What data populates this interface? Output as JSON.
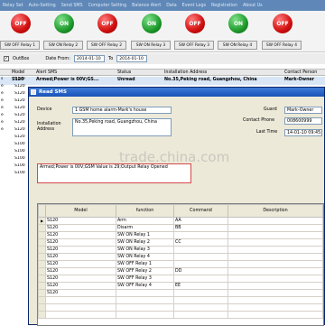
{
  "menu": [
    "Relay Set",
    "Auto-Setting",
    "Send SMS",
    "Computer Setting",
    "Balance Alert",
    "Data",
    "Event Logs",
    "Registration",
    "About Us"
  ],
  "relays": [
    {
      "state": "OFF",
      "color": "red",
      "label": "SW OFF Relay 1"
    },
    {
      "state": "ON",
      "color": "green",
      "label": "SW ON Relay 2"
    },
    {
      "state": "OFF",
      "color": "red",
      "label": "SW OFF Relay 2"
    },
    {
      "state": "ON",
      "color": "green",
      "label": "SW ON Relay 3"
    },
    {
      "state": "OFF",
      "color": "red",
      "label": "SW OFF Relay 3"
    },
    {
      "state": "ON",
      "color": "green",
      "label": "SW ON Relay 4"
    },
    {
      "state": "OFF",
      "color": "red",
      "label": "SW OFF Relay 4"
    }
  ],
  "filter": {
    "outbox": "OutBox",
    "date_from_label": "Date From:",
    "date_from": "2014-01-10",
    "to_label": "To",
    "date_to": "2014-01-10"
  },
  "bg_table": {
    "headers": [
      "Model",
      "Alert SMS",
      "Status",
      "Installation Address",
      "Contact Person"
    ],
    "first_row": {
      "model": "S120",
      "sms": "Armed;Power is 00V;GS...",
      "status": "Unread",
      "address": "No.35,Peking road, Guangzhou, China",
      "contact": "Mark-Owner"
    },
    "left_col": [
      {
        "n": "s",
        "m": "S120"
      },
      {
        "n": "e",
        "m": "S120"
      },
      {
        "n": "e",
        "m": "S120"
      },
      {
        "n": "e",
        "m": "S120"
      },
      {
        "n": "e",
        "m": "S120"
      },
      {
        "n": "e",
        "m": "S120"
      },
      {
        "n": "e",
        "m": "S120"
      },
      {
        "n": "e",
        "m": "S120"
      },
      {
        "n": "",
        "m": "S120"
      },
      {
        "n": "",
        "m": "S100"
      },
      {
        "n": "",
        "m": "S100"
      },
      {
        "n": "",
        "m": "S100"
      },
      {
        "n": "",
        "m": "S100"
      },
      {
        "n": "",
        "m": "S100"
      }
    ]
  },
  "dialog": {
    "title": "Read SMS",
    "device_label": "Device",
    "device": "1 GSM home alarm-Mark's house",
    "address_label": "Installation Address",
    "address": "No.35,Peking road, Guangzhou, China",
    "guard_label": "Guard",
    "guard": "Mark-Owner",
    "phone_label": "Contact Phone",
    "phone": "008600999",
    "last_time_label": "Last Time",
    "last_time": "14-01-10 09:45:1",
    "sms": "Armed;Power is 00V;GSM Value is 29;Output Relay Opened",
    "watermark": "trade.china.com",
    "grid": {
      "headers": [
        "Model",
        "function",
        "Command",
        "Description"
      ],
      "rows": [
        {
          "model": "S120",
          "function": "Arm",
          "command": "AA"
        },
        {
          "model": "S120",
          "function": "Disarm",
          "command": "BB"
        },
        {
          "model": "S120",
          "function": "SW ON Relay 1",
          "command": ""
        },
        {
          "model": "S120",
          "function": "SW ON Relay 2",
          "command": "CC"
        },
        {
          "model": "S120",
          "function": "SW ON Relay 3",
          "command": ""
        },
        {
          "model": "S120",
          "function": "SW ON Relay 4",
          "command": ""
        },
        {
          "model": "S120",
          "function": "SW OFF Relay 1",
          "command": ""
        },
        {
          "model": "S120",
          "function": "SW OFF Relay 2",
          "command": "DD"
        },
        {
          "model": "S120",
          "function": "SW OFF Relay 3",
          "command": ""
        },
        {
          "model": "S120",
          "function": "SW OFF Relay 4",
          "command": "EE"
        },
        {
          "model": "S120",
          "function": "",
          "command": ""
        },
        {
          "model": "",
          "function": "",
          "command": ""
        },
        {
          "model": "",
          "function": "",
          "command": ""
        },
        {
          "model": "",
          "function": "",
          "command": ""
        }
      ]
    }
  }
}
